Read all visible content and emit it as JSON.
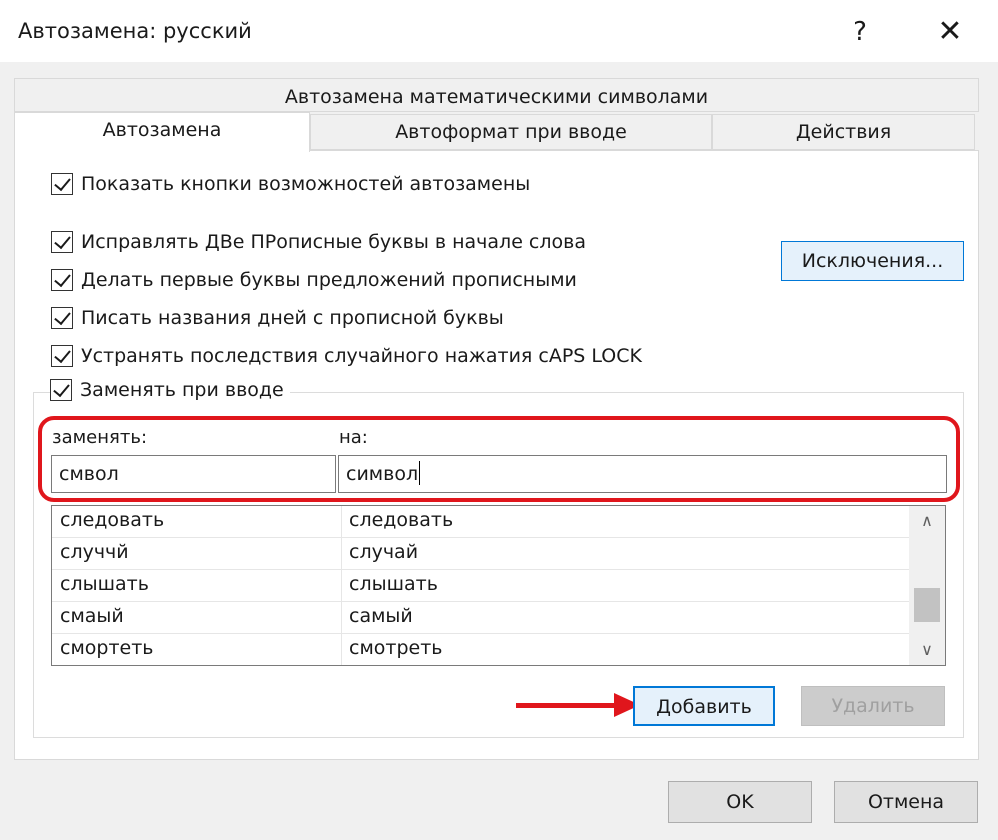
{
  "window": {
    "title": "Автозамена: русский",
    "help_glyph": "?",
    "close_glyph": "✕"
  },
  "tabs": {
    "row1": "Автозамена математическими символами",
    "autocorrect": "Автозамена",
    "autoformat": "Автоформат при вводе",
    "actions": "Действия"
  },
  "options": {
    "show_buttons": "Показать кнопки возможностей автозамены",
    "two_caps": "Исправлять ДВе ПРописные буквы в начале слова",
    "first_letter": "Делать первые буквы предложений прописными",
    "days": "Писать названия дней с прописной буквы",
    "caps_lock": "Устранять последствия случайного нажатия cAPS LOCK",
    "replace_typing": "Заменять при вводе"
  },
  "buttons": {
    "exceptions": "Исключения...",
    "add": "Добавить",
    "delete": "Удалить",
    "ok": "OK",
    "cancel": "Отмена"
  },
  "replace": {
    "replace_label": "заменять:",
    "with_label": "на:",
    "replace_value": "смвол",
    "with_value": "символ"
  },
  "list": {
    "rows": [
      {
        "from": "следовать",
        "to": "следовать"
      },
      {
        "from": "случчй",
        "to": "случай"
      },
      {
        "from": "слышать",
        "to": "слышать"
      },
      {
        "from": "смаый",
        "to": "самый"
      },
      {
        "from": "смортеть",
        "to": "смотреть"
      }
    ]
  },
  "colors": {
    "highlight": "#e0161c",
    "accent": "#0078d7"
  }
}
